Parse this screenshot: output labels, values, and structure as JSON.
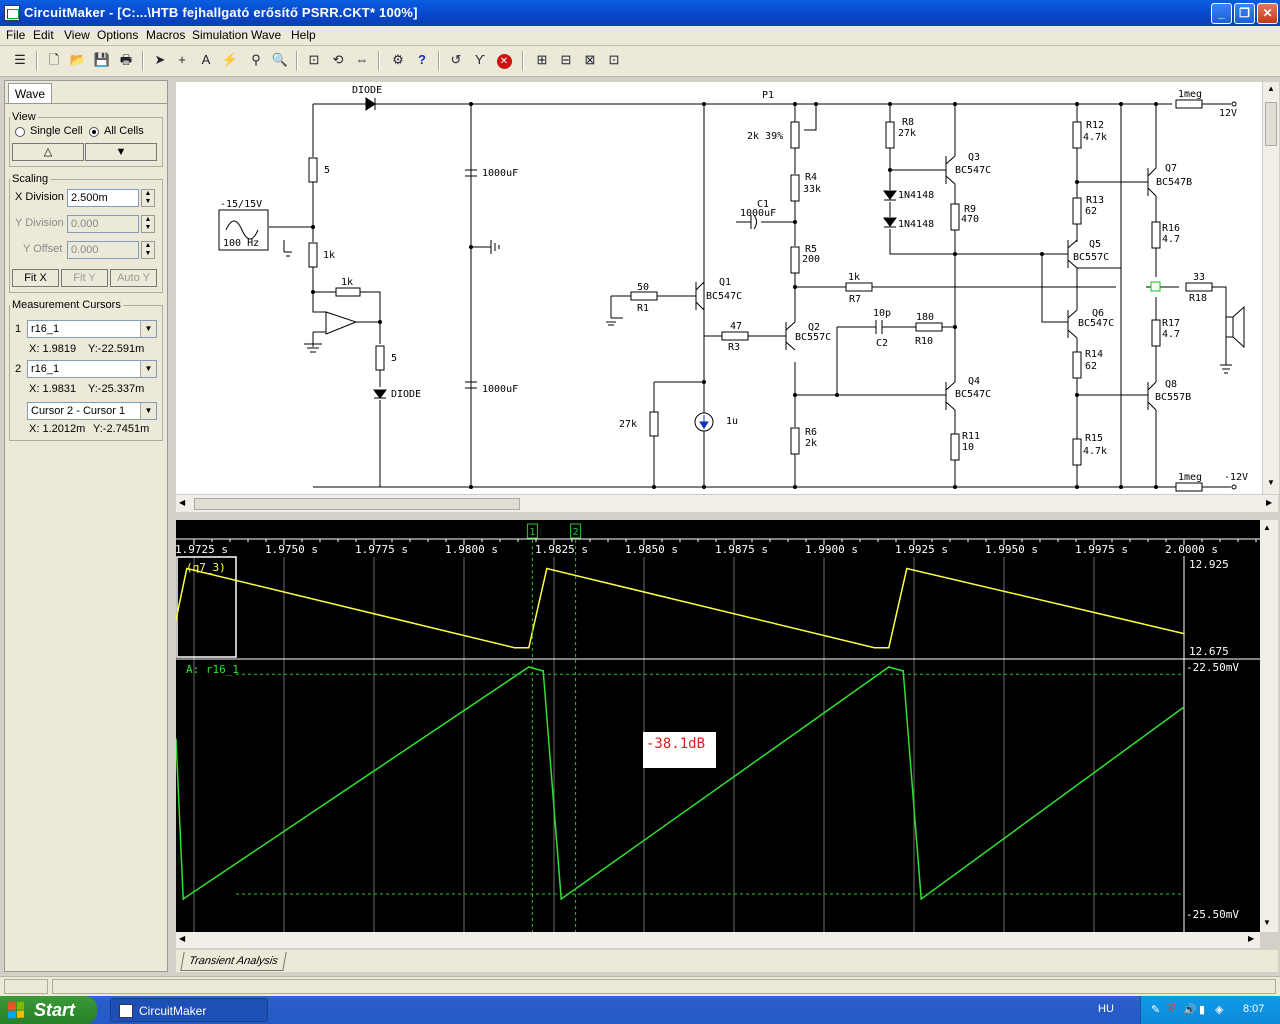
{
  "window": {
    "title": "CircuitMaker - [C:...\\HTB fejhallgató erősítő PSRR.CKT* 100%]"
  },
  "menu": [
    "File",
    "Edit",
    "View",
    "Options",
    "Macros",
    "Simulation",
    "Wave",
    "Help"
  ],
  "toolbar": {
    "icons": [
      "db-icon",
      "new-icon",
      "open-icon",
      "save-icon",
      "print-icon",
      "arrow-icon",
      "wire-icon",
      "text-icon",
      "probe-icon",
      "zoom-icon",
      "magnify-icon",
      "fit-icon",
      "rotate-icon",
      "mirror-icon",
      "digital-icon",
      "help-icon",
      "reset-icon",
      "step-icon",
      "stop-icon",
      "run1-icon",
      "run2-icon",
      "run3-icon",
      "run4-icon"
    ]
  },
  "panel": {
    "tab": "Wave",
    "view_legend": "View",
    "single_cell": "Single Cell",
    "all_cells": "All Cells",
    "up_btn": "△",
    "down_btn": "▼",
    "scaling_legend": "Scaling",
    "x_div_label": "X Division",
    "x_div_value": "2.500m",
    "y_div_label": "Y Division",
    "y_div_value": "0.000",
    "y_off_label": "Y Offset",
    "y_off_value": "0.000",
    "fit_x": "Fit X",
    "fit_y": "Fit Y",
    "auto_y": "Auto Y",
    "cursors_legend": "Measurement Cursors",
    "c1_num": "1",
    "c1_sel": "r16_1",
    "c1_x": "X: 1.9819",
    "c1_y": "Y:-22.591m",
    "c2_num": "2",
    "c2_sel": "r16_1",
    "c2_x": "X: 1.9831",
    "c2_y": "Y:-25.337m",
    "diff_sel": "Cursor 2 - Cursor 1",
    "diff_x": "X: 1.2012m",
    "diff_y": "Y:-2.7451m"
  },
  "schematic": {
    "labels": {
      "diode_top": "DIODE",
      "diode_bot": "DIODE",
      "src_name": "-15/15V",
      "src_freq": "100 Hz",
      "r_5a": "5",
      "r_1k_a": "1k",
      "r_1k_b": "1k",
      "r_5b": "5",
      "cap_a": "1000uF",
      "cap_b": "1000uF",
      "p1": "P1",
      "p1_val": "2k 39%",
      "r4": "R4",
      "r4_val": "33k",
      "c1": "C1",
      "c1_val": "1000uF",
      "r5": "R5",
      "r5_val": "200",
      "r1_val": "50",
      "r1": "R1",
      "q1": "Q1",
      "q1_type": "BC547C",
      "r3_val": "47",
      "r3": "R3",
      "q2": "Q2",
      "q2_type": "BC557C",
      "r27k": "27k",
      "isrc": "1u",
      "r6": "R6",
      "r6_val": "2k",
      "r8": "R8",
      "r8_val": "27k",
      "d1": "1N4148",
      "d2": "1N4148",
      "q3": "Q3",
      "q3_type": "BC547C",
      "r9": "R9",
      "r9_val": "470",
      "r7_val": "1k",
      "r7": "R7",
      "c2_val": "10p",
      "c2": "C2",
      "r10_val": "180",
      "r10": "R10",
      "q4": "Q4",
      "q4_type": "BC547C",
      "r11": "R11",
      "r11_val": "10",
      "r12": "R12",
      "r12_val": "4.7k",
      "r13": "R13",
      "r13_val": "62",
      "q5": "Q5",
      "q5_type": "BC557C",
      "q6": "Q6",
      "q6_type": "BC547C",
      "r14": "R14",
      "r14_val": "62",
      "r15": "R15",
      "r15_val": "4.7k",
      "q7": "Q7",
      "q7_type": "BC547B",
      "r16": "R16",
      "r16_val": "4.7",
      "r17": "R17",
      "r17_val": "4.7",
      "q8": "Q8",
      "q8_type": "BC557B",
      "r18_val": "33",
      "r18": "R18",
      "meg_top": "1meg",
      "v_top": "12V",
      "meg_bot": "1meg",
      "v_bot": "-12V"
    }
  },
  "wave": {
    "time_ticks": [
      "1.9725 s",
      "1.9750 s",
      "1.9775 s",
      "1.9800 s",
      "1.9825 s",
      "1.9850 s",
      "1.9875 s",
      "1.9900 s",
      "1.9925 s",
      "1.9950 s",
      "1.9975 s",
      "2.0000 s"
    ],
    "cursor1_label": "1",
    "cursor2_label": "2",
    "trace_top_name": "(q7_3)",
    "trace_top_max": "12.925",
    "trace_top_min": "12.675",
    "trace_bot_name": "A: r16_1",
    "trace_bot_max": "-22.50mV",
    "trace_bot_min": "-25.50mV",
    "annotation": "-38.1dB",
    "tab": "Transient Analysis",
    "colors": {
      "top": "#ffff40",
      "bottom": "#30e030",
      "grid": "#ffffff",
      "cursor": "#30c030"
    }
  },
  "chart_data": [
    {
      "type": "line",
      "title": "",
      "series": [
        {
          "name": "(q7_3)",
          "x": [
            1.972,
            1.9723,
            1.9814,
            1.9818,
            1.9823,
            1.9914,
            1.9918,
            1.9923,
            2.0
          ],
          "y": [
            12.77,
            12.915,
            12.69,
            12.69,
            12.915,
            12.69,
            12.69,
            12.915,
            12.73
          ]
        }
      ],
      "xlim": [
        1.972,
        2.0
      ],
      "ylim": [
        12.675,
        12.925
      ]
    },
    {
      "type": "line",
      "title": "",
      "series": [
        {
          "name": "A: r16_1",
          "x": [
            1.972,
            1.9722,
            1.9818,
            1.9822,
            1.9827,
            1.9918,
            1.9922,
            1.9927,
            2.0
          ],
          "y": [
            -23.4,
            -25.4,
            -22.5,
            -22.55,
            -25.4,
            -22.5,
            -22.55,
            -25.4,
            -23.0
          ]
        }
      ],
      "xlim": [
        1.972,
        2.0
      ],
      "ylim": [
        -25.5,
        -22.5
      ]
    }
  ],
  "taskbar": {
    "start": "Start",
    "task": "CircuitMaker",
    "lang": "HU",
    "clock": "8:07"
  }
}
